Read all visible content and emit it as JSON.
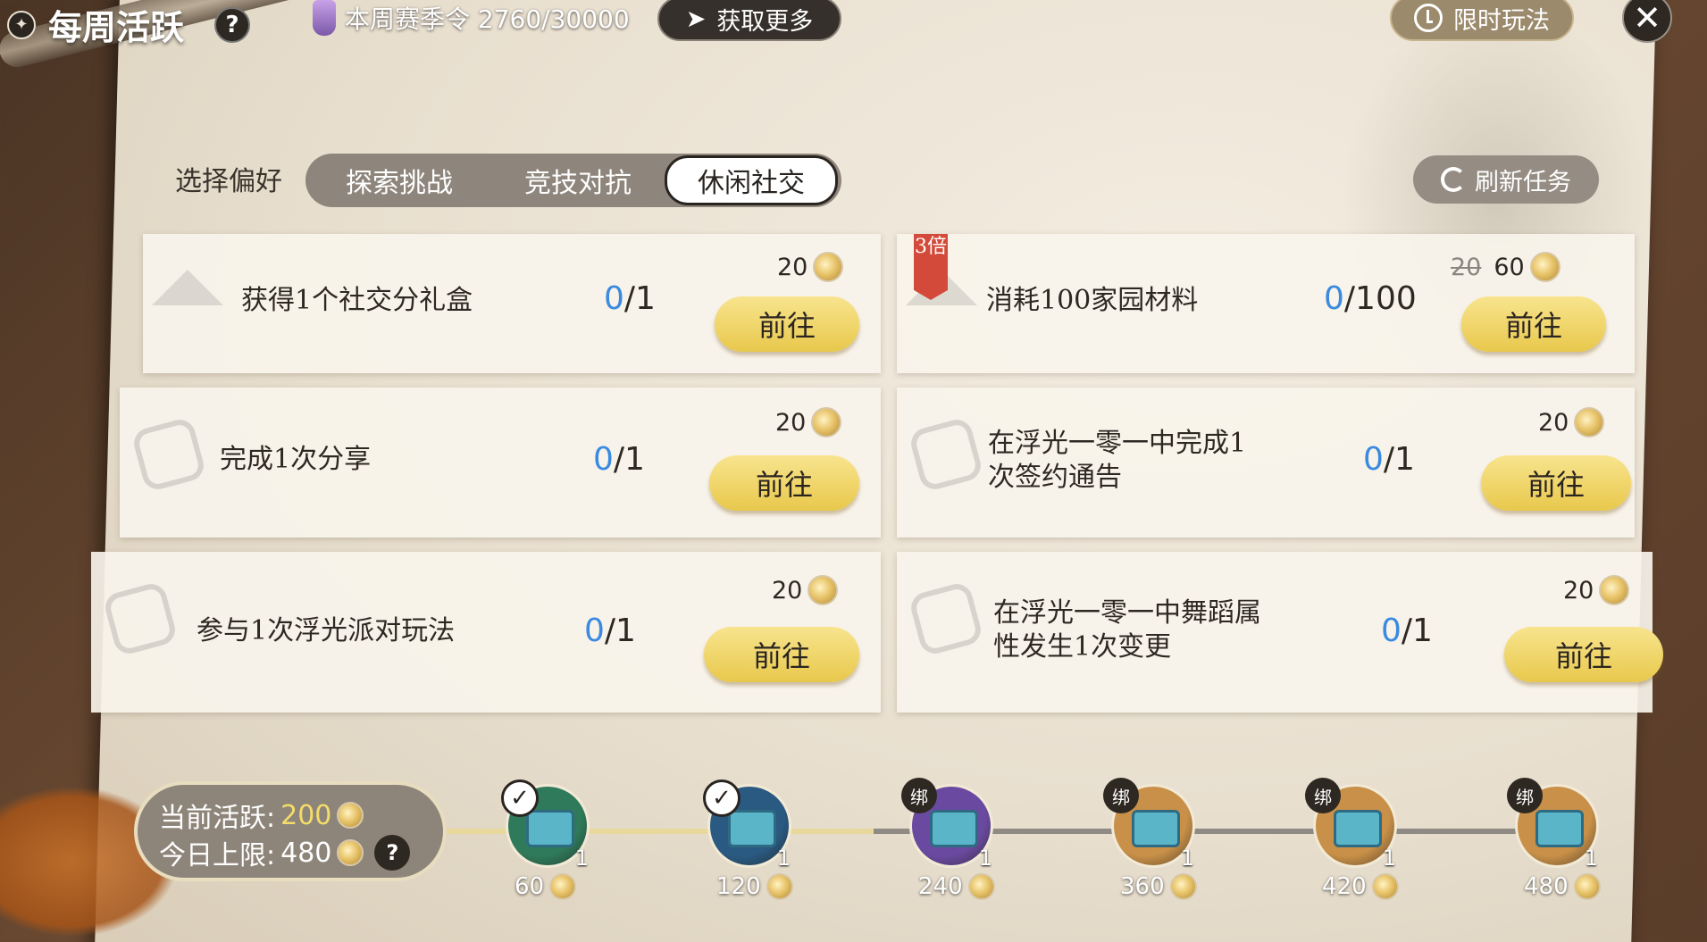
{
  "header": {
    "title": "每周活跃",
    "season_label": "本周赛季令 2760/30000",
    "get_more": "获取更多",
    "limited_play": "限时玩法"
  },
  "preferences": {
    "label": "选择偏好",
    "tabs": [
      {
        "label": "探索挑战",
        "active": false
      },
      {
        "label": "竞技对抗",
        "active": false
      },
      {
        "label": "休闲社交",
        "active": true
      }
    ],
    "refresh": "刷新任务"
  },
  "tasks": [
    {
      "text": "获得1个社交分礼盒",
      "current": "0",
      "total": "/1",
      "reward": "20",
      "button": "前往"
    },
    {
      "text": "消耗100家园材料",
      "current": "0",
      "total": "/100",
      "reward_old": "20",
      "reward": "60",
      "badge": "3倍",
      "button": "前往"
    },
    {
      "text": "完成1次分享",
      "current": "0",
      "total": "/1",
      "reward": "20",
      "button": "前往"
    },
    {
      "text_l1": "在浮光一零一中完成1",
      "text_l2": "次签约通告",
      "current": "0",
      "total": "/1",
      "reward": "20",
      "button": "前往"
    },
    {
      "text": "参与1次浮光派对玩法",
      "current": "0",
      "total": "/1",
      "reward": "20",
      "button": "前往"
    },
    {
      "text_l1": "在浮光一零一中舞蹈属",
      "text_l2": "性发生1次变更",
      "current": "0",
      "total": "/1",
      "reward": "20",
      "button": "前往"
    }
  ],
  "activity": {
    "current_label": "当前活跃:",
    "current_value": "200",
    "limit_label": "今日上限:",
    "limit_value": "480"
  },
  "milestones": [
    {
      "value": "60",
      "count": "1",
      "claimed": true,
      "bound": false,
      "color": "#2f7a5a"
    },
    {
      "value": "120",
      "count": "1",
      "claimed": true,
      "bound": false,
      "color": "#2a5a82"
    },
    {
      "value": "240",
      "count": "1",
      "claimed": false,
      "bound": true,
      "bind_label": "绑",
      "color": "#6a4aa0"
    },
    {
      "value": "360",
      "count": "1",
      "claimed": false,
      "bound": true,
      "bind_label": "绑",
      "color": "#c89048"
    },
    {
      "value": "420",
      "count": "1",
      "claimed": false,
      "bound": true,
      "bind_label": "绑",
      "color": "#c89048"
    },
    {
      "value": "480",
      "count": "1",
      "claimed": false,
      "bound": true,
      "bind_label": "绑",
      "color": "#c89048"
    }
  ],
  "icons": {
    "logo": "compass-icon",
    "help": "question-icon",
    "season": "season-token-icon",
    "arrow": "chevron-right-icon",
    "clock": "clock-icon",
    "close": "close-icon",
    "refresh": "refresh-icon",
    "coin": "activity-coin-icon",
    "chest": "treasure-chest-icon",
    "check": "check-icon"
  },
  "colors": {
    "progress_current": "#3a8ae0",
    "go_button": "#f0d86a",
    "badge": "#d34a3a",
    "activity_value": "#f4dc6a"
  }
}
